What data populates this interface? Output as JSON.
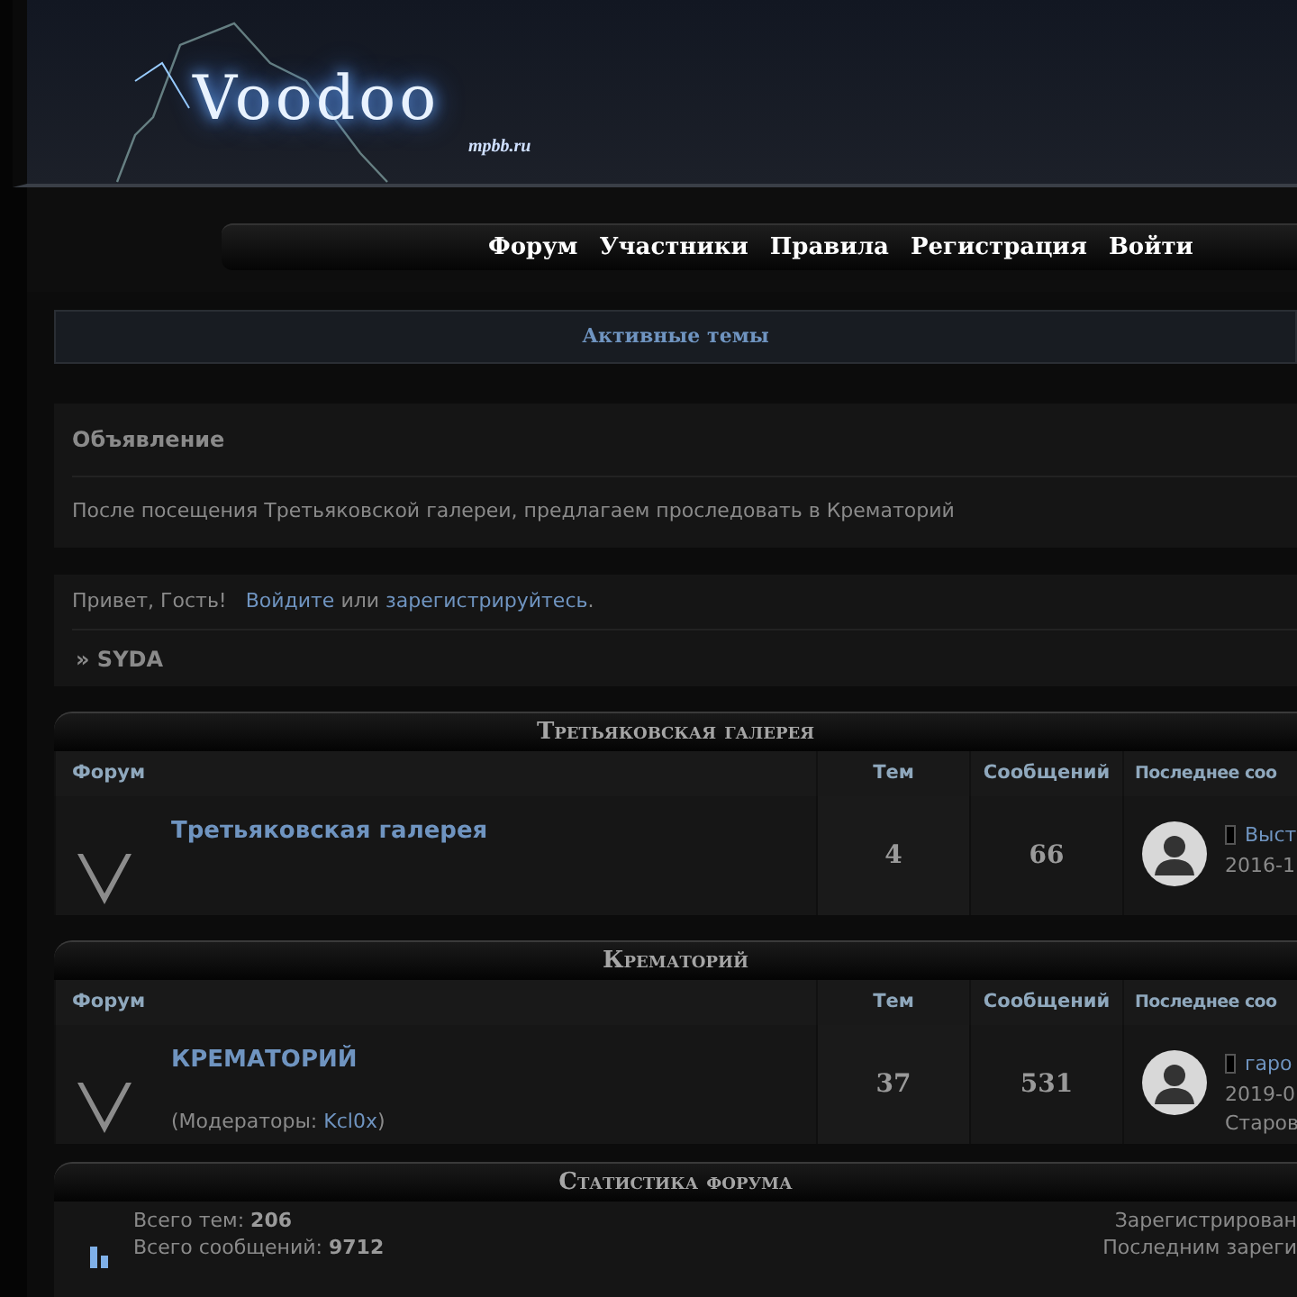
{
  "header": {
    "logo_text": "Voodoo",
    "logo_subtitle": "mpbb.ru"
  },
  "nav": [
    "Форум",
    "Участники",
    "Правила",
    "Регистрация",
    "Войти"
  ],
  "active_topics": "Активные темы",
  "announcement": {
    "title": "Объявление",
    "text": "После посещения Третьяковской галереи, предлагаем проследовать в Крематорий"
  },
  "welcome": {
    "greeting": "Привет, Гость!",
    "login_link": "Войдите",
    "middle": "или",
    "register_link": "зарегистрируйтесь",
    "end": "."
  },
  "breadcrumb": "» SYDA",
  "categories": [
    {
      "title": "Третьяковская галерея",
      "columns": [
        "Форум",
        "Тем",
        "Сообщений",
        "Последнее соо"
      ],
      "forums": [
        {
          "name": "Третьяковская галерея",
          "topics": "4",
          "posts": "66",
          "last_post": {
            "link": "Выст",
            "lines": [
              "2016-1"
            ]
          }
        }
      ]
    },
    {
      "title": "Крематорий",
      "columns": [
        "Форум",
        "Тем",
        "Сообщений",
        "Последнее соо"
      ],
      "forums": [
        {
          "name": "КРЕМАТОРИЙ",
          "moderators_label": "(Модераторы: ",
          "moderator": "Kcl0x",
          "moderators_end": ")",
          "topics": "37",
          "posts": "531",
          "last_post": {
            "link": "гаро",
            "lines": [
              "2019-0",
              "Старов"
            ]
          }
        }
      ]
    }
  ],
  "stats": {
    "title": "Статистика форума",
    "left": [
      "Всего тем: **206**",
      "Всего сообщений: **9712**"
    ],
    "right": [
      "Зарегистрирован",
      "Последним зареги"
    ]
  }
}
